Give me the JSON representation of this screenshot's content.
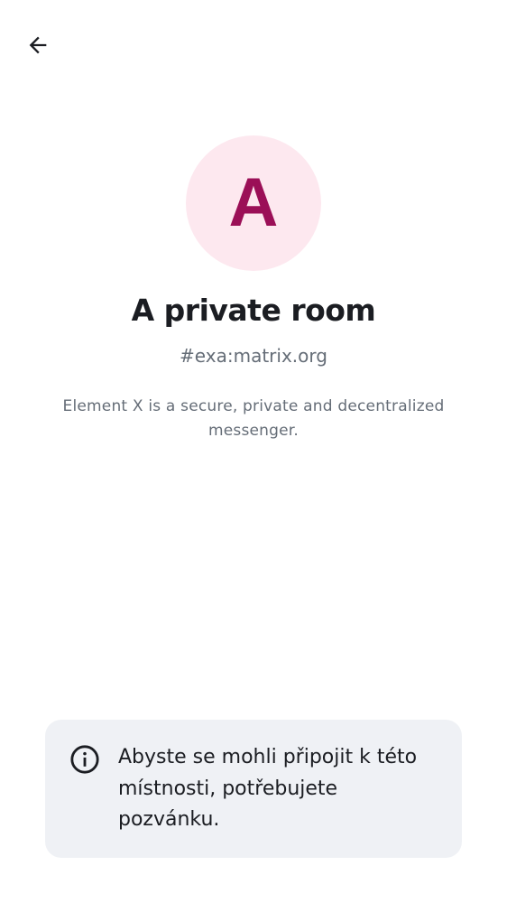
{
  "header": {
    "back_icon": "arrow-left-icon"
  },
  "room": {
    "avatar_letter": "A",
    "avatar_color": "#9b0f57",
    "avatar_background": "#fde8ef",
    "name": "A private room",
    "alias": "#exa:matrix.org",
    "description": "Element X is a secure, private and decentralized messenger."
  },
  "notice": {
    "icon": "info-icon",
    "text": "Abyste se mohli připojit k této místnosti, potřebujete pozvánku."
  }
}
